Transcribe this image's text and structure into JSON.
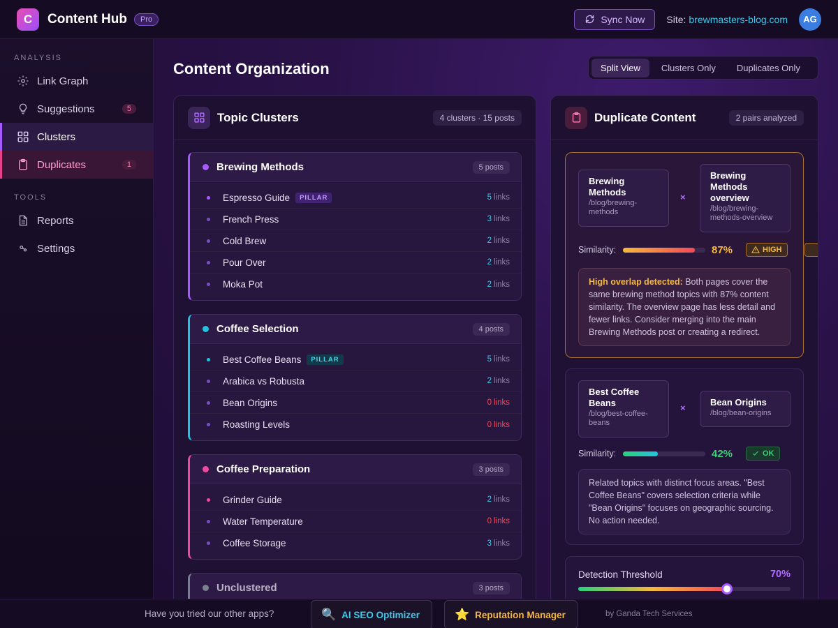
{
  "header": {
    "logo_letter": "C",
    "app_title": "Content Hub",
    "badge": "Pro",
    "sync_label": "Sync Now",
    "site_label": "Site:",
    "site_url": "brewmasters-blog.com",
    "avatar_initials": "AG"
  },
  "sidebar": {
    "sections": [
      {
        "title": "ANALYSIS",
        "items": [
          {
            "label": "Link Graph",
            "icon": "gear-icon"
          },
          {
            "label": "Suggestions",
            "icon": "lightbulb-icon",
            "count": "5"
          },
          {
            "label": "Clusters",
            "icon": "grid-icon",
            "active": true
          },
          {
            "label": "Duplicates",
            "icon": "clipboard-icon",
            "count": "1",
            "active": true
          }
        ]
      },
      {
        "title": "TOOLS",
        "items": [
          {
            "label": "Reports",
            "icon": "document-icon"
          },
          {
            "label": "Settings",
            "icon": "nodes-icon"
          }
        ]
      }
    ]
  },
  "main": {
    "title": "Content Organization",
    "view_tabs": [
      {
        "label": "Split View",
        "selected": true
      },
      {
        "label": "Clusters Only"
      },
      {
        "label": "Duplicates Only"
      }
    ]
  },
  "clusters_panel": {
    "title": "Topic Clusters",
    "meta": "4 clusters · 15 posts",
    "clusters": [
      {
        "name": "Brewing Methods",
        "count": "5 posts",
        "color": "#a45cff",
        "posts": [
          {
            "title": "Espresso Guide",
            "pillar": "PILLAR",
            "links": "5",
            "links_suffix": "links"
          },
          {
            "title": "French Press",
            "links": "3",
            "links_suffix": "links"
          },
          {
            "title": "Cold Brew",
            "links": "2",
            "links_suffix": "links"
          },
          {
            "title": "Pour Over",
            "links": "2",
            "links_suffix": "links"
          },
          {
            "title": "Moka Pot",
            "links": "2",
            "links_suffix": "links"
          }
        ]
      },
      {
        "name": "Coffee Selection",
        "count": "4 posts",
        "color": "#22c3dd",
        "posts": [
          {
            "title": "Best Coffee Beans",
            "pillar": "PILLAR",
            "links": "5",
            "links_suffix": "links"
          },
          {
            "title": "Arabica vs Robusta",
            "links": "2",
            "links_suffix": "links"
          },
          {
            "title": "Bean Origins",
            "links": "0",
            "links_suffix": "links"
          },
          {
            "title": "Roasting Levels",
            "links": "0",
            "links_suffix": "links"
          }
        ]
      },
      {
        "name": "Coffee Preparation",
        "count": "3 posts",
        "color": "#f04aa0",
        "posts": [
          {
            "title": "Grinder Guide",
            "links": "2",
            "links_suffix": "links"
          },
          {
            "title": "Water Temperature",
            "links": "0",
            "links_suffix": "links"
          },
          {
            "title": "Coffee Storage",
            "links": "3",
            "links_suffix": "links"
          }
        ]
      },
      {
        "name": "Unclustered",
        "count": "3 posts",
        "color": "#7a8090",
        "posts": []
      }
    ]
  },
  "duplicates_panel": {
    "title": "Duplicate Content",
    "meta": "2 pairs analyzed",
    "pairs": [
      {
        "a_name": "Brewing Methods",
        "a_path": "/blog/brewing-methods",
        "b_name": "Brewing Methods overview",
        "b_path": "/blog/brewing-methods-overview",
        "x": "×",
        "similarity_label": "Similarity:",
        "similarity": 87,
        "similarity_text": "87%",
        "tag": "HIGH",
        "tag_color": "#f5b83d",
        "note_strong": "High overlap detected:",
        "note": " Both pages cover the same brewing method topics with 87% content similarity. The overview page has less detail and fewer links. Consider merging into the main Brewing Methods post or creating a redirect."
      },
      {
        "a_name": "Best Coffee Beans",
        "a_path": "/blog/best-coffee-beans",
        "b_name": "Bean Origins",
        "b_path": "/blog/bean-origins",
        "x": "×",
        "similarity_label": "Similarity:",
        "similarity": 42,
        "similarity_text": "42%",
        "tag": "OK",
        "tag_color": "#3ad07a",
        "note": "Related topics with distinct focus areas. \"Best Coffee Beans\" covers selection criteria while \"Bean Origins\" focuses on geographic sourcing. No action needed."
      }
    ],
    "threshold": {
      "label": "Detection Threshold",
      "value": 70,
      "value_text": "70%"
    }
  },
  "footer": {
    "question": "Have you tried our other apps?",
    "apps": [
      {
        "label": "AI SEO Optimizer",
        "icon": "magnifier-icon",
        "color": "#3fc8e8"
      },
      {
        "label": "Reputation Manager",
        "icon": "star-icon",
        "color": "#f5b83d"
      }
    ],
    "by": "by Ganda Tech Services"
  },
  "colors": {
    "accent": "#a45cff",
    "link_ok": "#3fc8e8",
    "link_zero": "#f04a5a",
    "warning": "#f5b83d",
    "success": "#3ad07a"
  }
}
